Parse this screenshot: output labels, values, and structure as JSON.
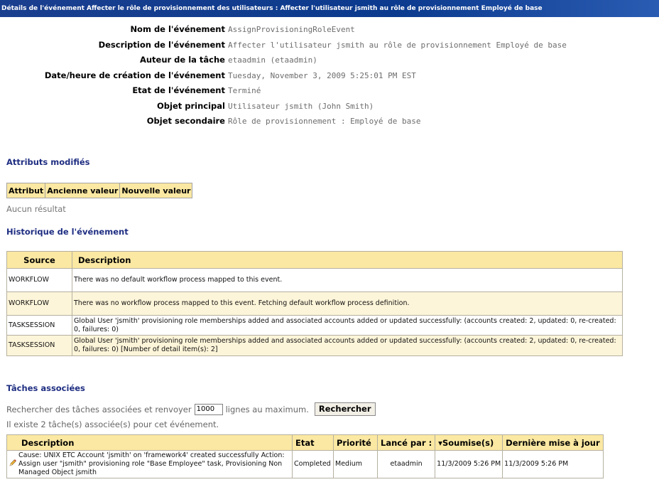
{
  "page_title": "Détails de l'événement Affecter le rôle de provisionnement des utilisateurs : Affecter l'utilisateur jsmith au rôle de provisionnement Employé de base",
  "details": [
    {
      "label": "Nom de l'événement",
      "value": "AssignProvisioningRoleEvent"
    },
    {
      "label": "Description de l'événement",
      "value": "Affecter l'utilisateur jsmith au rôle de provisionnement Employé de base"
    },
    {
      "label": "Auteur de la tâche",
      "value": "etaadmin (etaadmin)"
    },
    {
      "label": "Date/heure de création de l'événement",
      "value": "Tuesday, November 3, 2009 5:25:01 PM EST"
    },
    {
      "label": "Etat de l'événement",
      "value": "Terminé"
    },
    {
      "label": "Objet principal",
      "value": "Utilisateur jsmith (John Smith)"
    },
    {
      "label": "Objet secondaire",
      "value": "Rôle de provisionnement : Employé de base"
    }
  ],
  "modified_attributes": {
    "title": "Attributs modifiés",
    "columns": [
      "Attribut",
      "Ancienne valeur",
      "Nouvelle valeur"
    ],
    "empty_text": "Aucun résultat"
  },
  "history": {
    "title": "Historique de l'événement",
    "columns": [
      "Source",
      "Description"
    ],
    "rows": [
      {
        "source": "WORKFLOW",
        "description": "There was no default workflow process mapped to this event."
      },
      {
        "source": "WORKFLOW",
        "description": "There was no workflow process mapped to this event. Fetching default workflow process definition."
      },
      {
        "source": "TASKSESSION",
        "description": "Global User 'jsmith' provisioning role memberships added and associated accounts added or updated successfully: (accounts created: 2, updated: 0, re-created: 0, failures: 0)"
      },
      {
        "source": "TASKSESSION",
        "description": "Global User 'jsmith' provisioning role memberships added and associated accounts added or updated successfully: (accounts created: 2, updated: 0, re-created: 0, failures: 0) [Number of detail item(s): 2]"
      }
    ]
  },
  "tasks": {
    "title": "Tâches associées",
    "search_prefix": "Rechercher des tâches associées et renvoyer",
    "search_limit": "1000",
    "search_suffix": "lignes au maximum.",
    "search_button": "Rechercher",
    "count_text": "Il existe 2 tâche(s) associée(s) pour cet événement.",
    "columns": [
      "Description",
      "Etat",
      "Priorité",
      "Lancé par :",
      "▾Soumise(s)",
      "Dernière mise à jour"
    ],
    "rows": [
      {
        "icon": "pencil-icon",
        "description": "Cause: UNIX ETC Account 'jsmith' on 'framework4' created successfully Action: Assign user \"jsmith\" provisioning role \"Base Employee\" task, Provisioning Non Managed Object jsmith",
        "status": "Completed",
        "priority": "Medium",
        "launched_by": "etaadmin",
        "submitted": "11/3/2009 5:26 PM",
        "last_update": "11/3/2009 5:26 PM"
      }
    ]
  },
  "colors": {
    "title_bar": "#0b3a8e",
    "section_title": "#1f2e82",
    "header_fill": "#fbe8a2",
    "alt_row_fill": "#fdf5d9"
  }
}
